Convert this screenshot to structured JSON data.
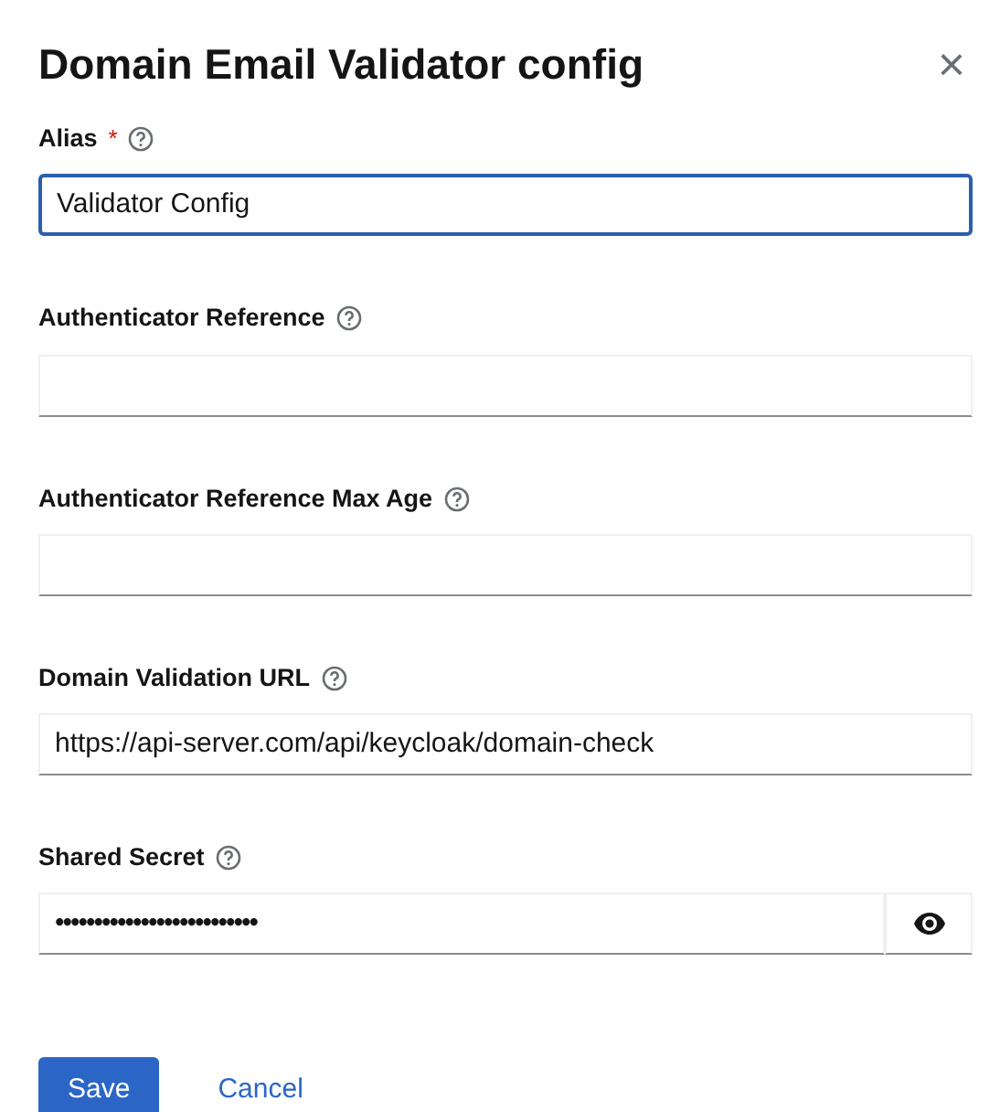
{
  "dialog": {
    "title": "Domain Email Validator config",
    "close": "×"
  },
  "fields": [
    {
      "label": "Alias",
      "required": true,
      "kind": "text",
      "focused": true,
      "value": "Validator Config"
    },
    {
      "label": "Authenticator Reference",
      "required": false,
      "kind": "text",
      "focused": false
    },
    {
      "label": "Authenticator Reference Max Age",
      "required": false,
      "kind": "text",
      "focused": false
    },
    {
      "label": "Domain Validation URL",
      "required": false,
      "kind": "text",
      "focused": false,
      "value": "https://api-server.com/api/keycloak/domain-check"
    },
    {
      "label": "Shared Secret",
      "required": false,
      "kind": "password",
      "focused": false,
      "value": "••••••••••••••••••••••••••"
    }
  ],
  "required_mark": "*",
  "buttons": [
    {
      "label": "Save",
      "kind": "primary"
    },
    {
      "label": "Cancel",
      "kind": "link"
    }
  ]
}
